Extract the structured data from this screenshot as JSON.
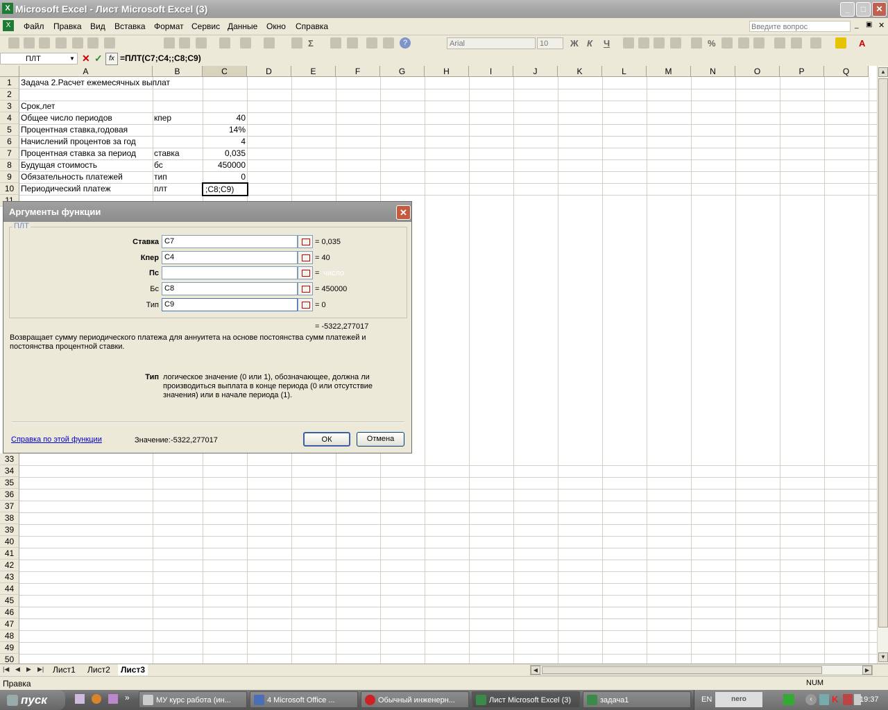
{
  "window": {
    "title": "Microsoft Excel - Лист Microsoft Excel (3)"
  },
  "menu": {
    "items": [
      "Файл",
      "Правка",
      "Вид",
      "Вставка",
      "Формат",
      "Сервис",
      "Данные",
      "Окно",
      "Справка"
    ],
    "help_placeholder": "Введите вопрос"
  },
  "toolbar": {
    "font_name": "Arial",
    "font_size": "10"
  },
  "formula_bar": {
    "name_box": "ПЛТ",
    "formula": "=ПЛТ(C7;C4;;C8;C9)"
  },
  "grid": {
    "columns": [
      "A",
      "B",
      "C",
      "D",
      "E",
      "F",
      "G",
      "H",
      "I",
      "J",
      "K",
      "L",
      "M",
      "N",
      "O",
      "P",
      "Q"
    ],
    "selected_column": "C",
    "row_numbers_top": [
      "1",
      "2",
      "3",
      "4",
      "5",
      "6",
      "7",
      "8",
      "9",
      "10",
      "11"
    ],
    "row_numbers_bottom": [
      "33",
      "34",
      "35",
      "36",
      "37",
      "38",
      "39",
      "40",
      "41",
      "42",
      "43",
      "44",
      "45",
      "46",
      "47",
      "48",
      "49",
      "50"
    ],
    "cells": {
      "a1": "Задача 2.Расчет ежемесячных выплат",
      "a3": "Срок,лет",
      "a4": "Общее число периодов",
      "b4": "кпер",
      "c4": "40",
      "a5": "Процентная ставка,годовая",
      "c5": "14%",
      "a6": "Начислений процентов за год",
      "c6": "4",
      "a7": "Процентная ставка за период",
      "b7": "ставка",
      "c7": "0,035",
      "a8": "Будущая стоимость",
      "b8": "бс",
      "c8": "450000",
      "a9": "Обязательность платежей",
      "b9": "тип",
      "c9": "0",
      "a10": "Периодический платеж",
      "b10": "плт",
      "c10": ";C8;C9)"
    }
  },
  "sheets": [
    "Лист1",
    "Лист2",
    "Лист3"
  ],
  "active_sheet": "Лист3",
  "status": {
    "mode": "Правка",
    "num": "NUM"
  },
  "dialog": {
    "title": "Аргументы функции",
    "function_name": "ПЛТ",
    "args": [
      {
        "label": "Ставка",
        "value": "C7",
        "result": "= 0,035"
      },
      {
        "label": "Кпер",
        "value": "C4",
        "result": "= 40"
      },
      {
        "label": "Пс",
        "value": "",
        "result": "= ",
        "hint": "число"
      },
      {
        "label": "Бс",
        "value": "C8",
        "result": "= 450000"
      },
      {
        "label": "Тип",
        "value": "C9",
        "result": "= 0"
      }
    ],
    "total": "= -5322,277017",
    "description": "Возвращает сумму периодического платежа для аннуитета на основе постоянства сумм платежей и постоянства процентной ставки.",
    "arg_help_name": "Тип",
    "arg_help_text": "логическое значение (0 или 1), обозначающее, должна ли производиться выплата в конце периода (0 или отсутствие значения) или в начале периода (1).",
    "help_link": "Справка по этой функции",
    "value_label": "Значение:",
    "value": "-5322,277017",
    "ok": "ОК",
    "cancel": "Отмена"
  },
  "taskbar": {
    "start": "пуск",
    "tasks": [
      "МУ курс работа (ин...",
      "4 Microsoft Office ...",
      "Обычный инженерн...",
      "Лист Microsoft Excel (3)",
      "задача1"
    ],
    "active_task": "Лист Microsoft Excel (3)",
    "lang": "EN",
    "clock": "19:37",
    "nero": "nero"
  }
}
